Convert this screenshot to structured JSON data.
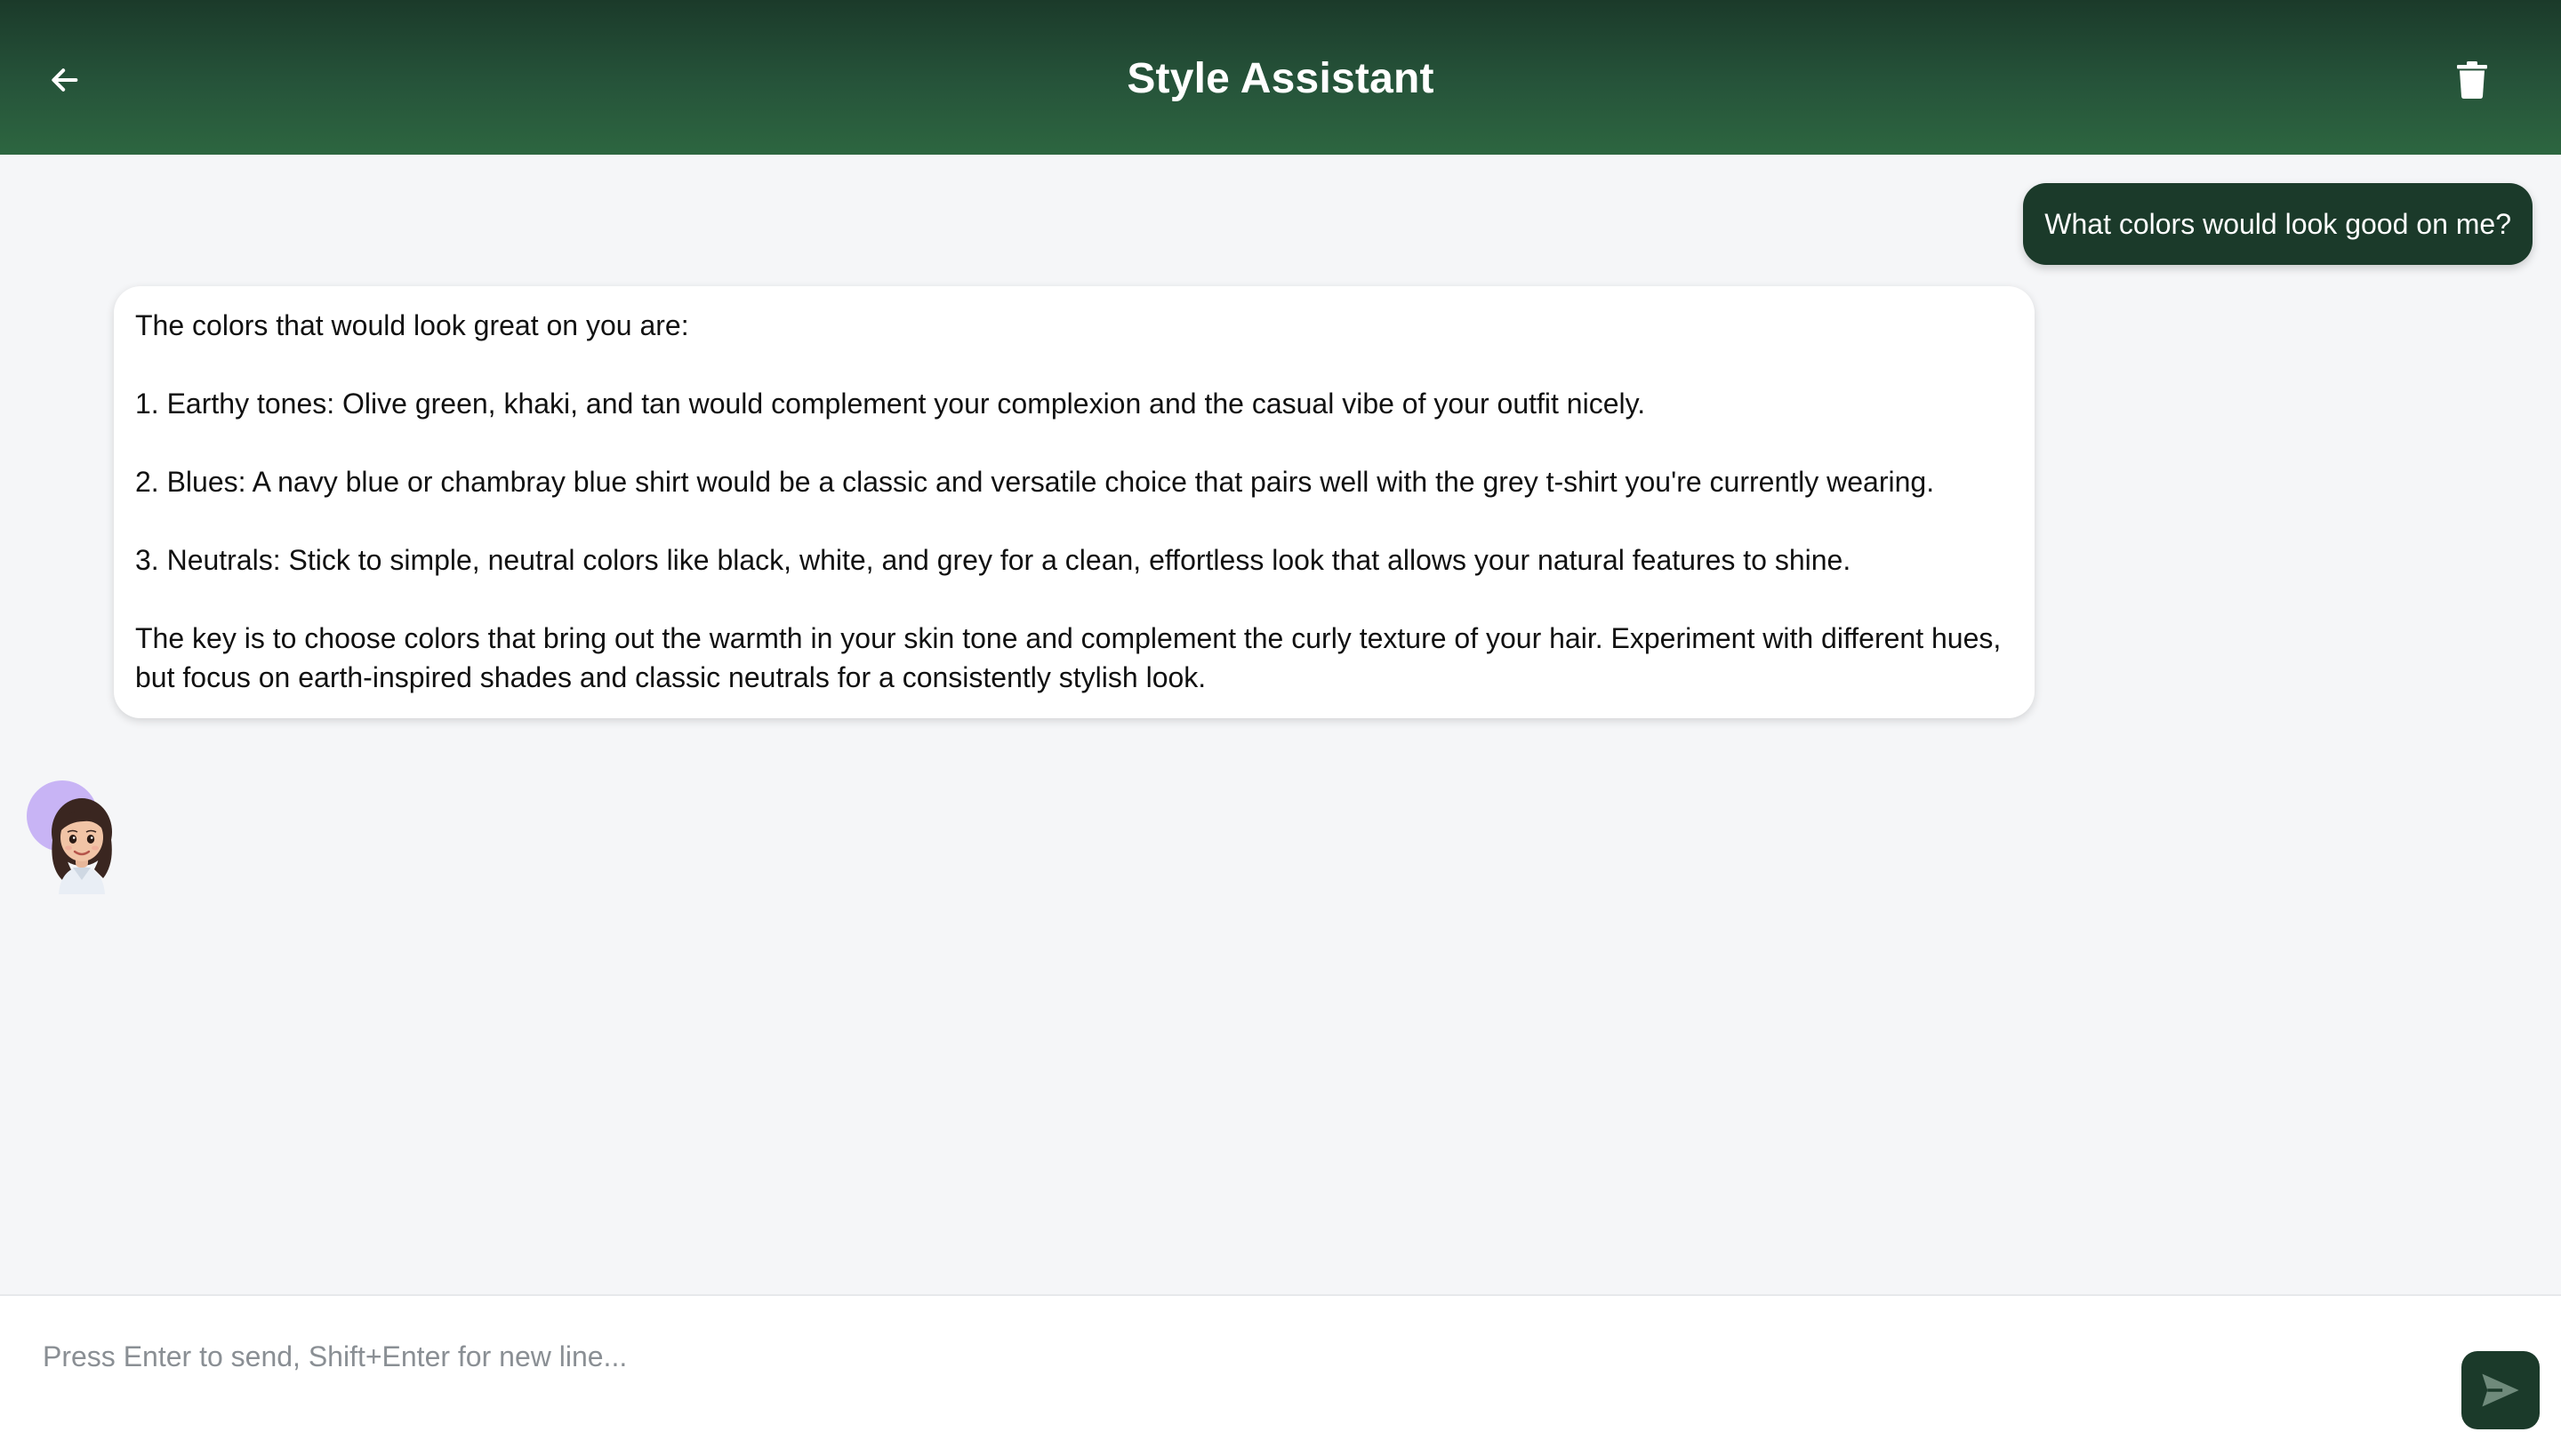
{
  "header": {
    "title": "Style Assistant",
    "back_icon": "arrow-left-icon",
    "delete_icon": "trash-icon"
  },
  "conversation": {
    "user_message": "What colors would look good on me?",
    "assistant_message": {
      "paragraphs": [
        "The colors that would look great on you are:",
        "1. Earthy tones: Olive green, khaki, and tan would complement your complexion and the casual vibe of your outfit nicely.",
        "2. Blues: A navy blue or chambray blue shirt would be a classic and versatile choice that pairs well with the grey t-shirt you're currently wearing.",
        "3. Neutrals: Stick to simple, neutral colors like black, white, and grey for a clean, effortless look that allows your natural features to shine.",
        "The key is to choose colors that bring out the warmth in your skin tone and complement the curly texture of your hair. Experiment with different hues, but focus on earth-inspired shades and classic neutrals for a consistently stylish look."
      ]
    }
  },
  "composer": {
    "placeholder": "Press Enter to send, Shift+Enter for new line...",
    "value": "",
    "send_icon": "send-icon"
  },
  "colors": {
    "header_dark": "#1b3a2a",
    "header_light": "#2d6640",
    "user_bubble": "#1b3a2a",
    "background": "#f5f6f8",
    "avatar_ring": "#c8b4f5"
  }
}
